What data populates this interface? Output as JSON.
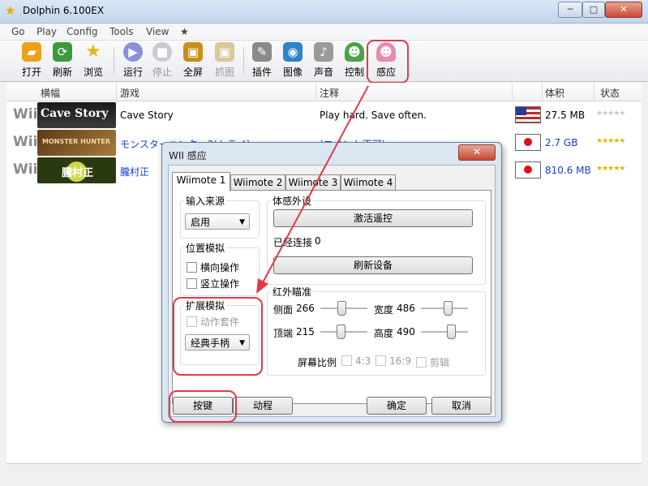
{
  "window": {
    "title": "Dolphin 6.100EX",
    "min_label": "─",
    "max_label": "□",
    "close_label": "✕"
  },
  "menu": [
    "Go",
    "Play",
    "Config",
    "Tools",
    "View",
    "★"
  ],
  "toolbar": [
    {
      "label": "打开",
      "icon": "folder-icon",
      "color": "#e9a21a"
    },
    {
      "label": "刷新",
      "icon": "refresh-icon",
      "color": "#3c9a3c"
    },
    {
      "label": "浏览",
      "icon": "star-icon",
      "color": "#e7c21c"
    },
    {
      "label": "运行",
      "icon": "play-icon",
      "color": "#8c8fd9"
    },
    {
      "label": "停止",
      "icon": "stop-icon",
      "color": "#c8c8d6",
      "disabled": true
    },
    {
      "label": "全屏",
      "icon": "fullscreen-icon",
      "color": "#c98f1c"
    },
    {
      "label": "抓图",
      "icon": "screenshot-icon",
      "color": "#d8c89a",
      "disabled": true
    },
    {
      "label": "插件",
      "icon": "wrench-icon",
      "color": "#8a8a8a"
    },
    {
      "label": "图像",
      "icon": "graphics-icon",
      "color": "#2e83c9"
    },
    {
      "label": "声音",
      "icon": "speaker-icon",
      "color": "#9a9a9a"
    },
    {
      "label": "控制",
      "icon": "gamepad-user-icon",
      "color": "#4aa34a"
    },
    {
      "label": "感应",
      "icon": "wiimote-user-icon",
      "color": "#e88ab0"
    }
  ],
  "list": {
    "columns": [
      "横幅",
      "游戏",
      "注释",
      "体积",
      "状态"
    ],
    "rows": [
      {
        "platform": "Wii",
        "banner_text": "Cave Story",
        "banner_colors": [
          "#1a1a1a",
          "#3a3a3a"
        ],
        "name": "Cave Story",
        "note": "Play hard. Save often.",
        "flag": "us-flag-icon",
        "size": "27.5 MB",
        "stars": "★★★★★",
        "star_color": "#c8c8c8",
        "name_color": "#000000"
      },
      {
        "platform": "Wii",
        "banner_text": "MONSTER HUNTER",
        "banner_colors": [
          "#5a3a16",
          "#a97a3c"
        ],
        "name": "モンスターハンター3(トライ)",
        "note": "(コメント不可)",
        "flag": "jp-flag-icon",
        "size": "2.7 GB",
        "stars": "★★★★★",
        "star_color": "#e0b400",
        "name_color": "#1a3ec8"
      },
      {
        "platform": "Wii",
        "banner_text": "朧村正",
        "banner_colors": [
          "#2a3a10",
          "#cfd84a"
        ],
        "name": "朧村正",
        "note": "",
        "flag": "jp-flag-icon",
        "size": "810.6 MB",
        "stars": "★★★★★",
        "star_color": "#e0b400",
        "name_color": "#1a3ec8"
      }
    ]
  },
  "dialog": {
    "title": "WII 感应",
    "close_label": "✕",
    "tabs": [
      "Wiimote 1",
      "Wiimote 2",
      "Wiimote 3",
      "Wiimote 4"
    ],
    "input_source": {
      "label": "输入来源",
      "value": "启用"
    },
    "position": {
      "label": "位置模拟",
      "options": [
        "横向操作",
        "竖立操作"
      ]
    },
    "extension": {
      "label": "扩展模拟",
      "option": "动作套件",
      "value": "经典手柄"
    },
    "peripheral": {
      "label": "体感外设",
      "activate": "激活遥控",
      "connected_label": "已经连接",
      "connected_value": "0",
      "refresh": "刷新设备"
    },
    "ir": {
      "label": "红外瞄准",
      "left": {
        "label": "侧面",
        "value": "266",
        "fraction": 0.45
      },
      "width": {
        "label": "宽度",
        "value": "486",
        "fraction": 0.6
      },
      "top": {
        "label": "顶端",
        "value": "215",
        "fraction": 0.42
      },
      "height": {
        "label": "高度",
        "value": "490",
        "fraction": 0.68
      },
      "aspect_label": "屏幕比例",
      "aspect": [
        "4:3",
        "16:9",
        "剪辑"
      ]
    },
    "buttons": {
      "keys": "按键",
      "motion": "动程",
      "ok": "确定",
      "cancel": "取消"
    }
  },
  "annotation_color": "#e23a4a"
}
